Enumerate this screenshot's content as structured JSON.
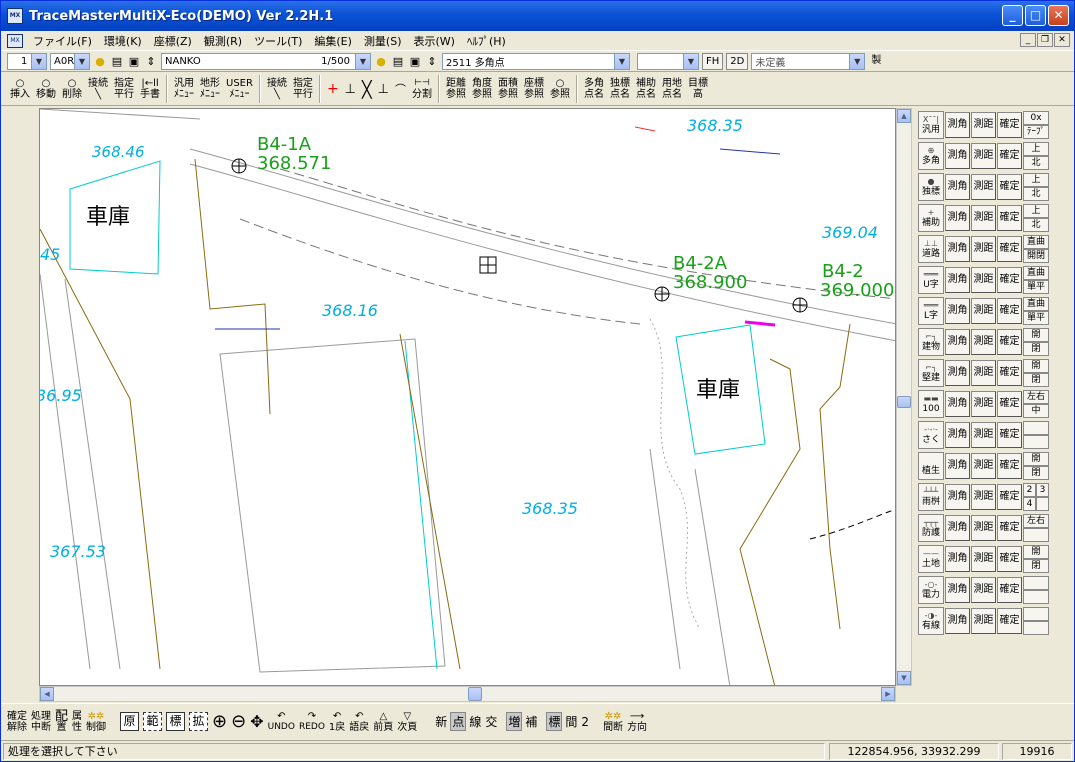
{
  "window": {
    "title": "TraceMasterMultiX-Eco(DEMO) Ver 2.2H.1",
    "icon_label": "MX"
  },
  "menu": [
    "ファイル(F)",
    "環境(K)",
    "座標(Z)",
    "観測(R)",
    "ツール(T)",
    "編集(E)",
    "測量(S)",
    "表示(W)",
    "ﾍﾙﾌﾟ(H)"
  ],
  "toolbar1": {
    "layer_no": "1",
    "layer_mode": "A0R",
    "layer_name": "NANKO",
    "scale": "1/500",
    "point_name": "2511 多角点",
    "empty_combo": "",
    "fh": "FH",
    "twod": "2D",
    "attr": "未定義",
    "make": "製"
  },
  "toolbar2": {
    "insert": "挿入",
    "move": "移動",
    "delete": "削除",
    "connect": "接続",
    "spec_parallel_1": "指定",
    "spec_parallel_2": "平行",
    "handwrite": "手書",
    "general_menu_1": "汎用",
    "general_menu_2": "ﾒﾆｭｰ",
    "terrain_menu_1": "地形",
    "terrain_menu_2": "ﾒﾆｭｰ",
    "user_menu_1": "USER",
    "user_menu_2": "ﾒﾆｭｰ",
    "connect2": "接続",
    "spec2_1": "指定",
    "spec2_2": "平行",
    "split": "分割",
    "ref_distance_1": "距離",
    "ref_angle_1": "角度",
    "ref_area_1": "面積",
    "ref_coord_1": "座標",
    "ref_label": "参照",
    "multi_pt_1": "多角",
    "single_pt_1": "独標",
    "aux_pt_1": "補助",
    "land_pt_1": "用地",
    "eye_1": "目標",
    "pt_name": "点名",
    "height": "高"
  },
  "map": {
    "labels": [
      {
        "text": "B4-1A",
        "color": "#1aa01a"
      },
      {
        "text": "368.571",
        "color": "#1aa01a"
      },
      {
        "text": "B4-2A",
        "color": "#1aa01a"
      },
      {
        "text": "368.900",
        "color": "#1aa01a"
      },
      {
        "text": "B4-2",
        "color": "#1aa01a"
      },
      {
        "text": "369.000",
        "color": "#1aa01a"
      },
      {
        "text": "368.35",
        "color": "#00b0e0"
      },
      {
        "text": "368.46",
        "color": "#00b0e0"
      },
      {
        "text": "369.04",
        "color": "#00b0e0"
      },
      {
        "text": "368.16",
        "color": "#00b0e0"
      },
      {
        "text": "368.35",
        "color": "#00b0e0"
      },
      {
        "text": "367.53",
        "color": "#00b0e0"
      },
      {
        "text": "45",
        "color": "#00b0e0"
      },
      {
        "text": "36.95",
        "color": "#00b0e0"
      }
    ],
    "garage_label": "車庫"
  },
  "right_panel": [
    {
      "label": "汎用",
      "sym": "X¯¯|",
      "a": "測角",
      "b": "測距",
      "c": "確定",
      "extra": [
        "0x 0y",
        "ﾃｰﾌﾟ"
      ]
    },
    {
      "label": "多角",
      "sym": "⊕",
      "a": "測角",
      "b": "測距",
      "c": "確定",
      "extra": [
        "上",
        "北"
      ]
    },
    {
      "label": "独標",
      "sym": "●",
      "a": "測角",
      "b": "測距",
      "c": "確定",
      "extra": [
        "上",
        "北"
      ]
    },
    {
      "label": "補助",
      "sym": "+",
      "a": "測角",
      "b": "測距",
      "c": "確定",
      "extra": [
        "上",
        "北"
      ]
    },
    {
      "label": "道路",
      "sym": "⊥⊥",
      "a": "測角",
      "b": "測距",
      "c": "確定",
      "extra": [
        "直曲",
        "開閉"
      ]
    },
    {
      "label": "U字",
      "sym": "═══",
      "a": "測角",
      "b": "測距",
      "c": "確定",
      "extra": [
        "直曲",
        "單平"
      ]
    },
    {
      "label": "L字",
      "sym": "═══",
      "a": "測角",
      "b": "測距",
      "c": "確定",
      "extra": [
        "直曲",
        "單平"
      ]
    },
    {
      "label": "建物",
      "sym": "⌐┐",
      "a": "測角",
      "b": "測距",
      "c": "確定",
      "extra": [
        "開",
        "閉"
      ]
    },
    {
      "label": "堅建",
      "sym": "⌐┐",
      "a": "測角",
      "b": "測距",
      "c": "確定",
      "extra": [
        "開",
        "閉"
      ]
    },
    {
      "label": "100",
      "sym": "▬▬",
      "a": "測角",
      "b": "測距",
      "c": "確定",
      "extra": [
        "左右",
        "中"
      ]
    },
    {
      "label": "さく",
      "sym": "-·-·-",
      "a": "測角",
      "b": "測距",
      "c": "確定",
      "extra": [
        "",
        ""
      ]
    },
    {
      "label": "植生",
      "sym": "",
      "a": "測角",
      "b": "測距",
      "c": "確定",
      "extra": [
        "開",
        "閉"
      ]
    },
    {
      "label": "雨桝",
      "sym": "┴┴┴",
      "a": "測角",
      "b": "測距",
      "c": "確定",
      "extra": [
        "2",
        "3",
        "4",
        ""
      ]
    },
    {
      "label": "防護",
      "sym": "┬┬┬",
      "a": "測角",
      "b": "測距",
      "c": "確定",
      "extra": [
        "左右",
        ""
      ]
    },
    {
      "label": "土地",
      "sym": "——",
      "a": "測角",
      "b": "測距",
      "c": "確定",
      "extra": [
        "開",
        "閉"
      ]
    },
    {
      "label": "電力",
      "sym": "-○-",
      "a": "測角",
      "b": "測距",
      "c": "確定",
      "extra": [
        "",
        ""
      ]
    },
    {
      "label": "有線",
      "sym": "-◑-",
      "a": "測角",
      "b": "測距",
      "c": "確定",
      "extra": [
        "",
        ""
      ]
    }
  ],
  "bottom": {
    "confirm_release_1": "確定",
    "confirm_release_2": "解除",
    "process_stop_1": "処理",
    "process_stop_2": "中断",
    "place_1": "配",
    "place_2": "置",
    "attr_1": "属",
    "attr_2": "性",
    "control": "制御",
    "orig": "原",
    "range": "範",
    "std": "標",
    "zoom": "拡",
    "undo": "UNDO",
    "redo": "REDO",
    "back1": "1戻",
    "hdr_back": "語戻",
    "prev": "前頁",
    "next": "次頁",
    "modes": [
      "新",
      "点",
      "線",
      "交"
    ],
    "modes2": [
      "増",
      "補"
    ],
    "modes3": [
      "標",
      "間",
      "2"
    ],
    "interval": "間断",
    "direction": "方向"
  },
  "status": {
    "message": "処理を選択して下さい",
    "coords": "122854.956,  33932.299",
    "count": "19916"
  }
}
